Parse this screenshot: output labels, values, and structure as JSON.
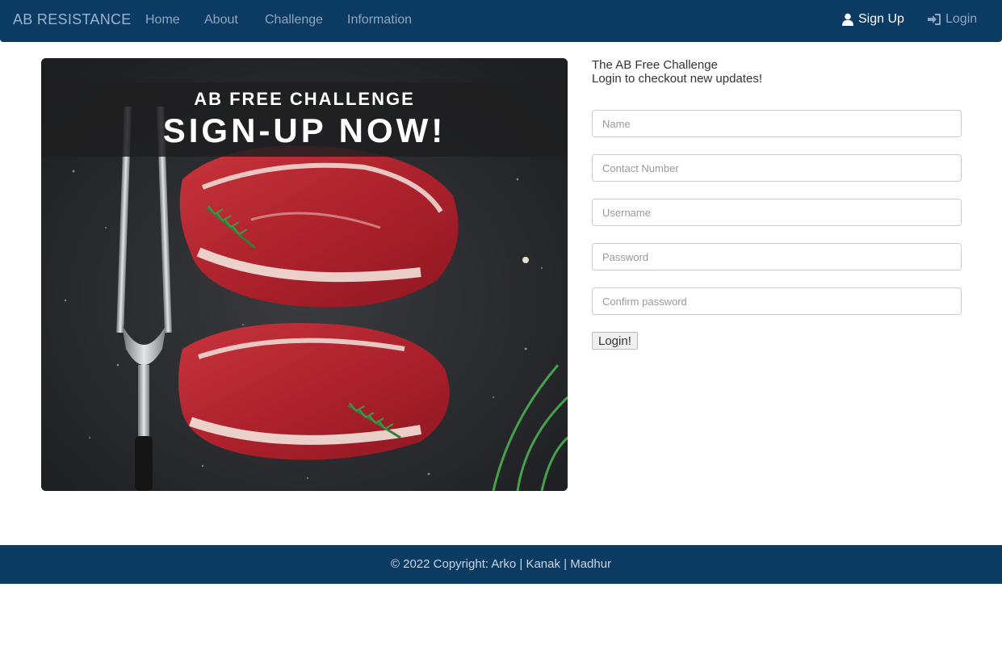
{
  "nav": {
    "brand": "AB RESISTANCE",
    "links": [
      "Home",
      "About",
      "Challenge",
      "Information"
    ],
    "signup_label": "Sign Up",
    "login_label": "Login",
    "signup_icon": "user-icon",
    "login_icon": "sign-in-icon"
  },
  "hero": {
    "line1": "AB FREE CHALLENGE",
    "line2": "SIGN-UP NOW!"
  },
  "intro": {
    "line1": "The AB Free Challenge",
    "line2": "Login to checkout new updates!"
  },
  "form": {
    "name_placeholder": "Name",
    "contact_placeholder": "Contact Number",
    "username_placeholder": "Username",
    "password_placeholder": "Password",
    "confirm_placeholder": "Confirm password",
    "submit_label": "Login!"
  },
  "footer": {
    "text": "© 2022 Copyright: Arko | Kanak | Madhur"
  },
  "colors": {
    "navbar": "#0b3a63",
    "footer": "#0b3a63"
  }
}
